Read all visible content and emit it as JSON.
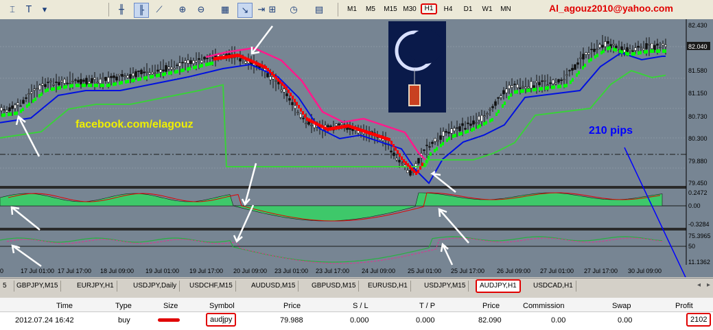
{
  "toolbar": {
    "timeframes": [
      "M1",
      "M5",
      "M15",
      "M30",
      "H1",
      "H4",
      "D1",
      "W1",
      "MN"
    ],
    "active_timeframe": "H1",
    "email": "Al_agouz2010@yahoo.com"
  },
  "chart": {
    "symbol": "AUDJPY,H1",
    "facebook_text": "facebook.com/elagouz",
    "pips_text": "210 pips",
    "price_axis": [
      "82.430",
      "82.040",
      "81.580",
      "81.150",
      "80.730",
      "80.300",
      "79.880",
      "79.450"
    ],
    "current_price": "82.040",
    "macd_axis": [
      "0.2472",
      "0.00",
      "-0.3284"
    ],
    "osc_axis": [
      "75.3965",
      "50",
      "11.1362"
    ],
    "time_axis": [
      "17 Jul 01:00",
      "17 Jul 17:00",
      "18 Jul 09:00",
      "19 Jul 01:00",
      "19 Jul 17:00",
      "20 Jul 09:00",
      "23 Jul 01:00",
      "23 Jul 17:00",
      "24 Jul 09:00",
      "25 Jul 01:00",
      "25 Jul 17:00",
      "26 Jul 09:00",
      "27 Jul 01:00",
      "27 Jul 17:00",
      "30 Jul 09:00"
    ],
    "time_axis_leading": "0"
  },
  "tabs": {
    "leading": "5",
    "items": [
      "GBPJPY,M15",
      "EURJPY,H1",
      "USDJPY,Daily",
      "USDCHF,M15",
      "AUDUSD,M15",
      "GBPUSD,M15",
      "EURUSD,H1",
      "USDJPY,M15",
      "AUDJPY,H1",
      "USDCAD,H1"
    ],
    "active": "AUDJPY,H1"
  },
  "trade_table": {
    "headers": {
      "time": "Time",
      "type": "Type",
      "size": "Size",
      "symbol": "Symbol",
      "price": "Price",
      "sl": "S / L",
      "tp": "T / P",
      "price2": "Price",
      "commission": "Commission",
      "swap": "Swap",
      "profit": "Profit"
    },
    "row": {
      "time": "2012.07.24 16:42",
      "type": "buy",
      "symbol": "audjpy",
      "price": "79.988",
      "sl": "0.000",
      "tp": "0.000",
      "price2": "82.090",
      "commission": "0.00",
      "swap": "0.00",
      "profit": "2102"
    }
  },
  "colors": {
    "chart_bg": "#778593",
    "bull": "#00ff00",
    "bear": "#ff0000",
    "ma_blue": "#0010e0",
    "trail_pink": "#ff1a8c",
    "trail_green": "#3ad03a",
    "highlight": "#e00000",
    "arrow": "#ffffff",
    "pips_text": "#0000ff",
    "fb_text": "#f0f000"
  }
}
